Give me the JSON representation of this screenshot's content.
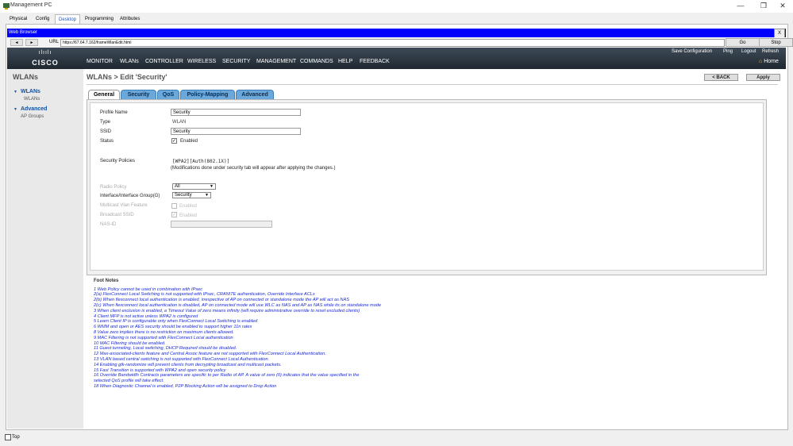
{
  "window": {
    "title": "Management PC"
  },
  "pc_tabs": [
    "Physical",
    "Config",
    "Desktop",
    "Programming",
    "Attributes"
  ],
  "browser": {
    "title": "Web Browser",
    "close": "X",
    "back": "◄",
    "forward": "►",
    "url_label": "URL",
    "url": "https://67.64.7.162/frameWlanEdit.html",
    "go": "Go",
    "stop": "Stop"
  },
  "cisco": {
    "logo_bars": "ılıılı",
    "logo_text": "CISCO",
    "menu": [
      "MONITOR",
      "WLANs",
      "CONTROLLER",
      "WIRELESS",
      "SECURITY",
      "MANAGEMENT",
      "COMMANDS",
      "HELP",
      "FEEDBACK"
    ],
    "top_links": [
      "Save Configuration",
      "Ping",
      "Logout",
      "Refresh"
    ],
    "home": "Home"
  },
  "sidebar": {
    "heading": "WLANs",
    "sections": [
      {
        "label": "WLANs",
        "sub": "WLANs"
      },
      {
        "label": "Advanced",
        "sub": "AP Groups"
      }
    ]
  },
  "page": {
    "breadcrumb": "WLANs > Edit  'Security'",
    "back_button": "< BACK",
    "apply_button": "Apply",
    "tabs": [
      "General",
      "Security",
      "QoS",
      "Policy-Mapping",
      "Advanced"
    ]
  },
  "form": {
    "profile_name_label": "Profile Name",
    "profile_name_value": "Security",
    "type_label": "Type",
    "type_value": "WLAN",
    "ssid_label": "SSID",
    "ssid_value": "Security",
    "status_label": "Status",
    "status_checkbox": "Enabled",
    "policies_label": "Security Policies",
    "policies_value": "[WPA2][Auth(802.1X)]",
    "policies_note": "(Modifications done under security tab will appear after applying the changes.)",
    "radio_policy_label": "Radio Policy",
    "radio_policy_value": "All",
    "interface_label": "Interface/Interface Group(G)",
    "interface_value": "Security",
    "multicast_label": "Multicast Vlan Feature",
    "multicast_checkbox": "Enabled",
    "broadcast_label": "Broadcast SSID",
    "broadcast_checkbox": "Enabled",
    "nas_label": "NAS-ID",
    "nas_value": ""
  },
  "footnotes": {
    "title": "Foot Notes",
    "items": [
      "1 Web Policy cannot be used in combination with IPsec",
      "2(a) FlexConnect Local Switching is not supported with IPsec, CRANITE authentication, Override Interface ACLs",
      "2(b) When flexconnect local authentication is enabled, irrespective of AP on connected or standalone mode the AP will act as NAS",
      "2(c) When flexconnect local authentication is disabled, AP on connected mode will use WLC as NAS and AP as NAS while its on standalone mode",
      "3 When client exclusion is enabled, a Timeout Value of zero means infinity (will require administrative override to reset excluded clients)",
      "4 Client MFP is not active unless WPA2 is configured",
      "5 Learn Client IP is configurable only when FlexConnect Local Switching is enabled",
      "6 WMM and open or AES security should be enabled to support higher 11n rates",
      "8 Value zero implies there is no restriction on maximum clients allowed.",
      "9 MAC Filtering is not supported with FlexConnect Local authentication",
      "10 MAC Filtering should be enabled.",
      "11 Guest tunneling, Local switching, DHCP Required should be disabled.",
      "12 Max-associated-clients feature and Central Assoc feature are not supported with FlexConnect Local Authentication.",
      "13 VLAN based central switching is not supported with FlexConnect Local Authentication.",
      "14 Enabling gtk-randomize will prevent clients from decrypting broadcast and multicast packets.",
      "15 Fast Transition is supported with WPA2 and open security policy",
      "16 Override Bandwidth Contracts parameters are specific to per Radio of AP. A value of zero (0) indicates that the value specified in the",
      "selected QoS profile will take effect.",
      "18 When Diagnostic Channel is enabled, P2P Blocking Action will be assigned to Drop Action"
    ]
  },
  "statusbar": {
    "top_label": "Top"
  },
  "colors": {
    "accent": "#0000ff",
    "tab_blue": "#6aa8dc",
    "footnote": "#1a2ad8"
  }
}
